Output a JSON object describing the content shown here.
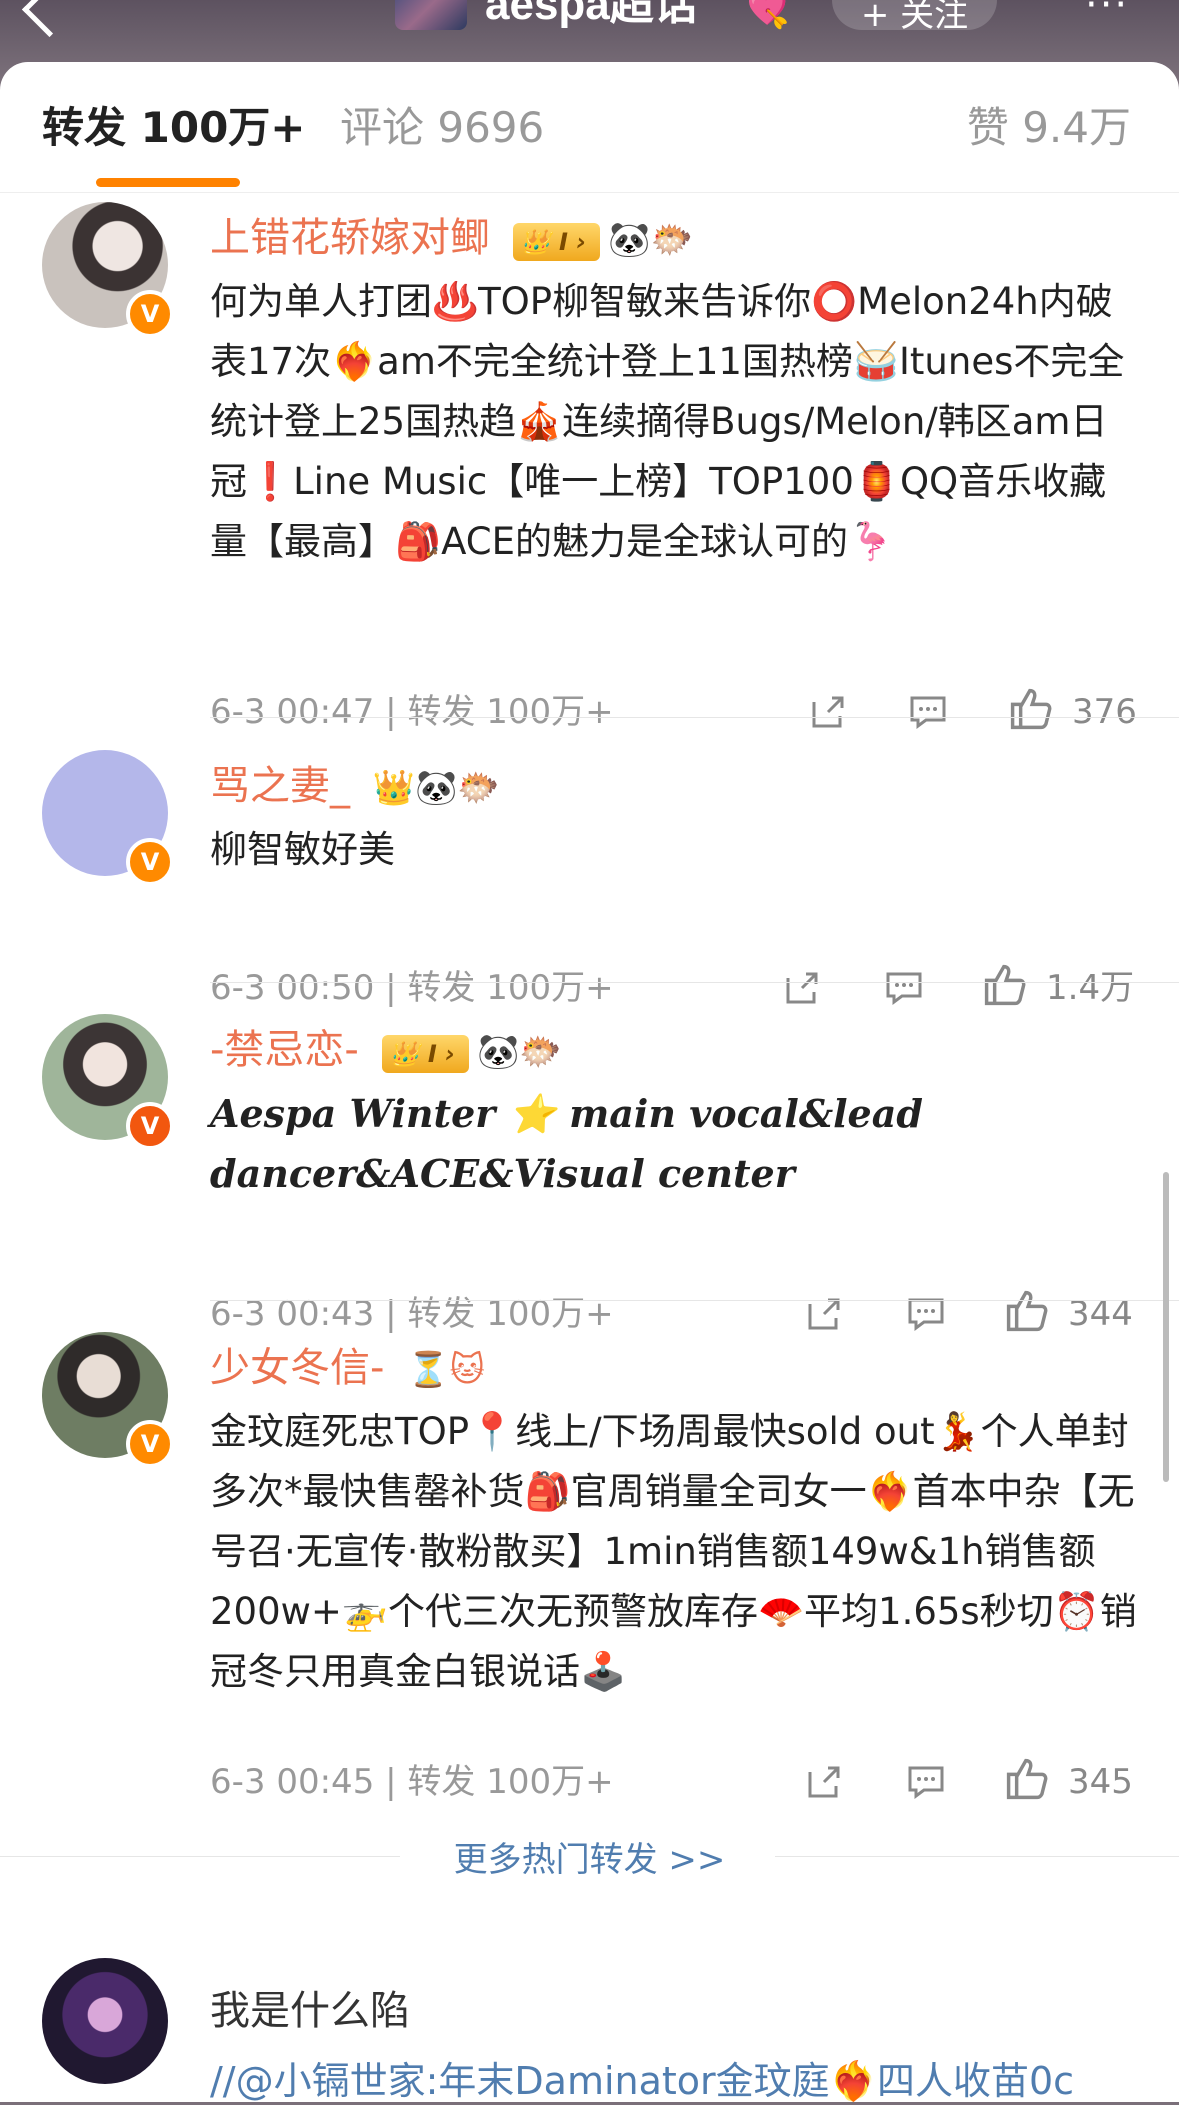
{
  "topbar": {
    "title": "aespa超话",
    "follow": "+ 关注"
  },
  "tabs": {
    "forward": "转发 100万+",
    "comment": "评论 9696",
    "like": "赞 9.4万"
  },
  "colors": {
    "accent": "#ff8200",
    "username": "#eb7350",
    "link": "#507daf"
  },
  "comments": [
    {
      "username": "上错花轿嫁对鲫",
      "level": "I",
      "badges": "🐼🐡",
      "text": "何为单人打团♨️TOP柳智敏来告诉你⭕️Melon24h内破表17次❤️‍🔥am不完全统计登上11国热榜🥁Itunes不完全统计登上25国热趋🎪连续摘得Bugs/Melon/韩区am日冠❗️Line Music【唯一上榜】TOP100🏮QQ音乐收藏量【最高】🎒ACE的魅力是全球认可的🦩",
      "time": "6-3 00:47",
      "forward": "转发 100万+",
      "likes": "376"
    },
    {
      "username": "骂之妻_",
      "badges": "👑🐼🐡",
      "text": "柳智敏好美",
      "time": "6-3 00:50",
      "forward": "转发 100万+",
      "likes": "1.4万"
    },
    {
      "username": "-禁忌恋-",
      "level": "I",
      "badges": "🐼🐡",
      "text": "Aespa Winter ⭐ main vocal&lead dancer&ACE&Visual center",
      "time": "6-3 00:43",
      "forward": "转发 100万+",
      "likes": "344"
    },
    {
      "username": "少女冬信-",
      "badges": "⏳🐱",
      "text": "金玟庭死忠TOP📍线上/下场周最快sold out💃个人单封多次*最快售罄补货🎒官周销量全司女一❤️‍🔥首本中杂【无号召·无宣传·散粉散买】1min销售额149w&1h销售额200w+🚁个代三次无预警放库存🪭平均1.65s秒切⏰销冠冬只用真金白银说话🕹️",
      "time": "6-3 00:45",
      "forward": "转发 100万+",
      "likes": "345"
    }
  ],
  "more_hot": "更多热门转发 >>",
  "last": {
    "username": "我是什么陷",
    "text": "//@小镉世家:年末Daminator金玟庭❤️‍🔥四人收苗0c"
  }
}
